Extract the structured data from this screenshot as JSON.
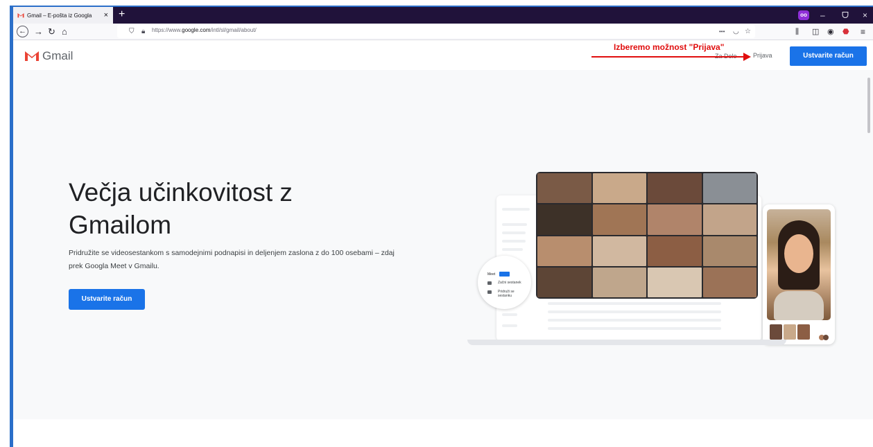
{
  "browser": {
    "tab_title": "Gmail – E-pošta iz Googla",
    "tab_close": "×",
    "new_tab": "+",
    "window_controls": [
      "–",
      "ᗜ",
      "×"
    ],
    "extension_badge": "oo",
    "url_prefix": "https://www.",
    "url_domain": "google.com",
    "url_path": "/intl/sl/gmail/about/",
    "page_actions": "•••",
    "icons": [
      "back-icon",
      "forward-icon",
      "reload-icon",
      "home-icon",
      "shield-icon",
      "lock-icon",
      "pocket-icon",
      "star-icon",
      "library-icon",
      "sidebar-icon",
      "account-icon",
      "adblock-icon",
      "menu-icon"
    ]
  },
  "header": {
    "logo_text": "Gmail",
    "za_delo": "Za Delo",
    "signin": "Prijava",
    "create_account": "Ustvarite račun"
  },
  "annotation": {
    "text": "Izberemo možnost \"Prijava\"",
    "color": "#e00d0d"
  },
  "hero": {
    "title": "Večja učinkovitost z Gmailom",
    "description": "Pridružite se videosestankom s samodejnimi podnapisi in deljenjem zaslona z do 100 osebami – zdaj prek Googla Meet v Gmailu.",
    "cta": "Ustvarite račun"
  },
  "illustration": {
    "meet_label": "Meet",
    "meet_start": "Začni sestanek",
    "meet_join": "Pridruži se sestanku"
  },
  "colors": {
    "accent": "#1a73e8",
    "gmail_red": "#ea4335",
    "tab_bar": "#20123a"
  }
}
